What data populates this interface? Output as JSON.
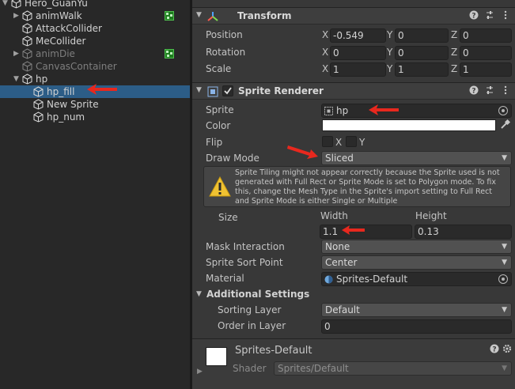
{
  "hierarchy": {
    "items": [
      {
        "label": "Hero_GuanYu",
        "depth": 0,
        "expanded": true,
        "dim": false,
        "selected": false,
        "prefab": false
      },
      {
        "label": "animWalk",
        "depth": 1,
        "expanded": false,
        "dim": false,
        "selected": false,
        "prefab": true
      },
      {
        "label": "AttackCollider",
        "depth": 1,
        "expanded": null,
        "dim": false,
        "selected": false,
        "prefab": false
      },
      {
        "label": "MeCollider",
        "depth": 1,
        "expanded": null,
        "dim": false,
        "selected": false,
        "prefab": false
      },
      {
        "label": "animDie",
        "depth": 1,
        "expanded": false,
        "dim": true,
        "selected": false,
        "prefab": true
      },
      {
        "label": "CanvasContainer",
        "depth": 1,
        "expanded": null,
        "dim": true,
        "selected": false,
        "prefab": false
      },
      {
        "label": "hp",
        "depth": 1,
        "expanded": true,
        "dim": false,
        "selected": false,
        "prefab": false
      },
      {
        "label": "hp_fill",
        "depth": 2,
        "expanded": null,
        "dim": false,
        "selected": true,
        "prefab": false
      },
      {
        "label": "New Sprite",
        "depth": 2,
        "expanded": null,
        "dim": false,
        "selected": false,
        "prefab": false
      },
      {
        "label": "hp_num",
        "depth": 2,
        "expanded": null,
        "dim": false,
        "selected": false,
        "prefab": false
      }
    ]
  },
  "transform": {
    "title": "Transform",
    "position": {
      "label": "Position",
      "x": "-0.549",
      "y": "0",
      "z": "0"
    },
    "rotation": {
      "label": "Rotation",
      "x": "0",
      "y": "0",
      "z": "0"
    },
    "scale": {
      "label": "Scale",
      "x": "1",
      "y": "1",
      "z": "1"
    }
  },
  "axes": {
    "x": "X",
    "y": "Y",
    "z": "Z"
  },
  "sprite_renderer": {
    "title": "Sprite Renderer",
    "sprite_label": "Sprite",
    "sprite_value": "hp",
    "color_label": "Color",
    "color_value": "#ffffff",
    "flip_label": "Flip",
    "flip_x": "X",
    "flip_y": "Y",
    "draw_mode_label": "Draw Mode",
    "draw_mode_value": "Sliced",
    "warning": "Sprite Tiling might not appear correctly because the Sprite used is not generated with Full Rect or Sprite Mode is set to Polygon mode. To fix this, change the Mesh Type in the Sprite's import setting to Full Rect and Sprite Mode is either Single or Multiple",
    "size_label": "Size",
    "width_label": "Width",
    "height_label": "Height",
    "width_value": "1.1",
    "height_value": "0.13",
    "mask_label": "Mask Interaction",
    "mask_value": "None",
    "sort_point_label": "Sprite Sort Point",
    "sort_point_value": "Center",
    "material_label": "Material",
    "material_value": "Sprites-Default",
    "additional_label": "Additional Settings",
    "sorting_layer_label": "Sorting Layer",
    "sorting_layer_value": "Default",
    "order_label": "Order in Layer",
    "order_value": "0"
  },
  "material_preview": {
    "name": "Sprites-Default",
    "shader_label": "Shader",
    "shader_value": "Sprites/Default"
  },
  "colors": {
    "selection": "#2c5d87",
    "annotation_arrow": "#e8281e",
    "prefab_icon": "#1e7d1e"
  }
}
